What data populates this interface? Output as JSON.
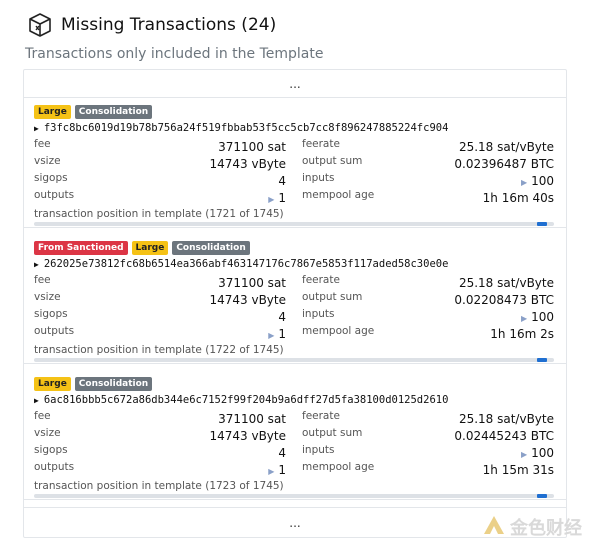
{
  "header": {
    "title": "Missing Transactions (24)",
    "subtitle": "Transactions only included in the Template"
  },
  "ellipsis": "...",
  "labels": {
    "fee": "fee",
    "vsize": "vsize",
    "sigops": "sigops",
    "outputs": "outputs",
    "feerate": "feerate",
    "output_sum": "output sum",
    "inputs": "inputs",
    "mempool_age": "mempool age"
  },
  "transactions": [
    {
      "badges": [
        {
          "text": "Large",
          "color": "#f5c216"
        },
        {
          "text": "Consolidation",
          "color": "#6c757d"
        }
      ],
      "txid": "f3fc8bc6019d19b78b756a24f519fbbab53f5cc5cb7cc8f896247885224fc904",
      "fee": "371100 sat",
      "vsize": "14743 vByte",
      "sigops": "4",
      "outputs": "1",
      "feerate": "25.18 sat/vByte",
      "output_sum": "0.02396487 BTC",
      "inputs": "100",
      "mempool_age": "1h 16m 40s",
      "position_text": "transaction position in template (1721 of 1745)",
      "position_fraction": 0.986
    },
    {
      "badges": [
        {
          "text": "From Sanctioned",
          "color": "#dc3545"
        },
        {
          "text": "Large",
          "color": "#f5c216"
        },
        {
          "text": "Consolidation",
          "color": "#6c757d"
        }
      ],
      "txid": "262025e73812fc68b6514ea366abf463147176c7867e5853f117aded58c30e0e",
      "fee": "371100 sat",
      "vsize": "14743 vByte",
      "sigops": "4",
      "outputs": "1",
      "feerate": "25.18 sat/vByte",
      "output_sum": "0.02208473 BTC",
      "inputs": "100",
      "mempool_age": "1h 16m 2s",
      "position_text": "transaction position in template (1722 of 1745)",
      "position_fraction": 0.987
    },
    {
      "badges": [
        {
          "text": "Large",
          "color": "#f5c216"
        },
        {
          "text": "Consolidation",
          "color": "#6c757d"
        }
      ],
      "txid": "6ac816bbb5c672a86db344e6c7152f99f204b9a6dff27d5fa38100d0125d2610",
      "fee": "371100 sat",
      "vsize": "14743 vByte",
      "sigops": "4",
      "outputs": "1",
      "feerate": "25.18 sat/vByte",
      "output_sum": "0.02445243 BTC",
      "inputs": "100",
      "mempool_age": "1h 15m 31s",
      "position_text": "transaction position in template (1723 of 1745)",
      "position_fraction": 0.987
    }
  ],
  "watermark": {
    "text": "金色财经",
    "icon": "golden-logo-icon"
  }
}
